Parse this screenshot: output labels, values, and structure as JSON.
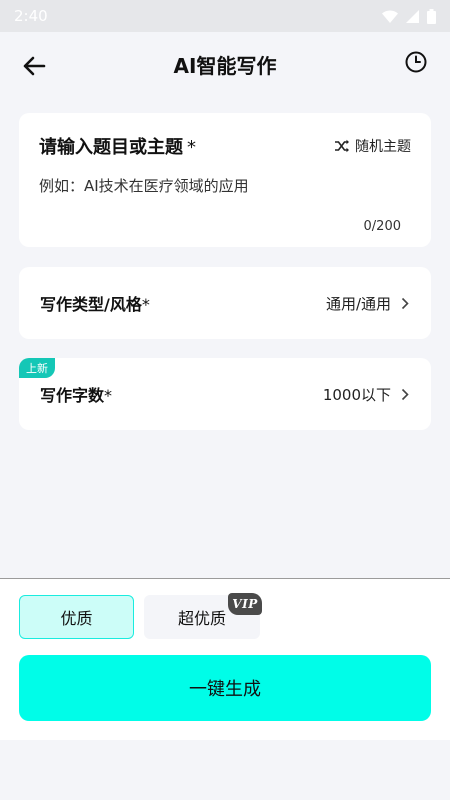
{
  "status_bar": {
    "time": "2:40"
  },
  "header": {
    "title": "AI智能写作"
  },
  "topic": {
    "label": "请输入题目或主题",
    "required": "*",
    "random_label": "随机主题",
    "placeholder": "例如：AI技术在医疗领域的应用",
    "count": "0/200"
  },
  "writing_type": {
    "label": "写作类型/风格",
    "required": "*",
    "value": "通用/通用"
  },
  "word_count": {
    "badge": "上新",
    "label": "写作字数",
    "required": "*",
    "value": "1000以下"
  },
  "quality": {
    "options": [
      {
        "label": "优质",
        "selected": true
      },
      {
        "label": "超优质",
        "selected": false
      }
    ],
    "vip_badge": "VIP"
  },
  "generate_button": "一键生成",
  "colors": {
    "accent": "#00fde8",
    "selected_bg": "#ccfdf8",
    "badge": "#14c7b6"
  }
}
